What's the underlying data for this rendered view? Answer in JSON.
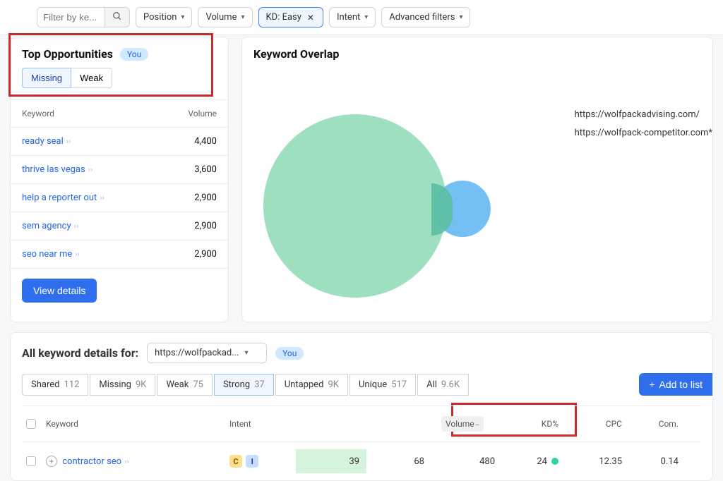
{
  "filters": {
    "search_placeholder": "Filter by ke...",
    "position": "Position",
    "volume": "Volume",
    "kd": "KD: Easy",
    "intent": "Intent",
    "advanced": "Advanced filters"
  },
  "opportunities": {
    "title": "Top Opportunities",
    "you_badge": "You",
    "tabs": {
      "missing": "Missing",
      "weak": "Weak"
    },
    "columns": {
      "keyword": "Keyword",
      "volume": "Volume"
    },
    "rows": [
      {
        "kw": "ready seal",
        "vol": "4,400"
      },
      {
        "kw": "thrive las vegas",
        "vol": "3,600"
      },
      {
        "kw": "help a reporter out",
        "vol": "2,900"
      },
      {
        "kw": "sem agency",
        "vol": "2,900"
      },
      {
        "kw": "seo near me",
        "vol": "2,900"
      }
    ],
    "view_details": "View details"
  },
  "overlap": {
    "title": "Keyword Overlap",
    "legend": [
      "https://wolfpackadvising.com/",
      "https://wolfpack-competitor.com*"
    ]
  },
  "details": {
    "title": "All keyword details for:",
    "selected_domain": "https://wolfpackad...",
    "you_badge": "You",
    "tabs": [
      {
        "label": "Shared",
        "count": "112"
      },
      {
        "label": "Missing",
        "count": "9K"
      },
      {
        "label": "Weak",
        "count": "75"
      },
      {
        "label": "Strong",
        "count": "37"
      },
      {
        "label": "Untapped",
        "count": "9K"
      },
      {
        "label": "Unique",
        "count": "517"
      },
      {
        "label": "All",
        "count": "9.6K"
      }
    ],
    "active_tab": 3,
    "add_to_list": "Add to list",
    "columns": {
      "keyword": "Keyword",
      "intent": "Intent",
      "serp": "",
      "pos": "",
      "volume": "Volume",
      "kd": "KD%",
      "cpc": "CPC",
      "com": "Com."
    },
    "rows": [
      {
        "kw": "contractor seo",
        "intent": [
          "C",
          "I"
        ],
        "serp": "39",
        "pos": "68",
        "volume": "480",
        "kd": "24",
        "cpc": "12.35",
        "com": "0.14"
      }
    ]
  }
}
